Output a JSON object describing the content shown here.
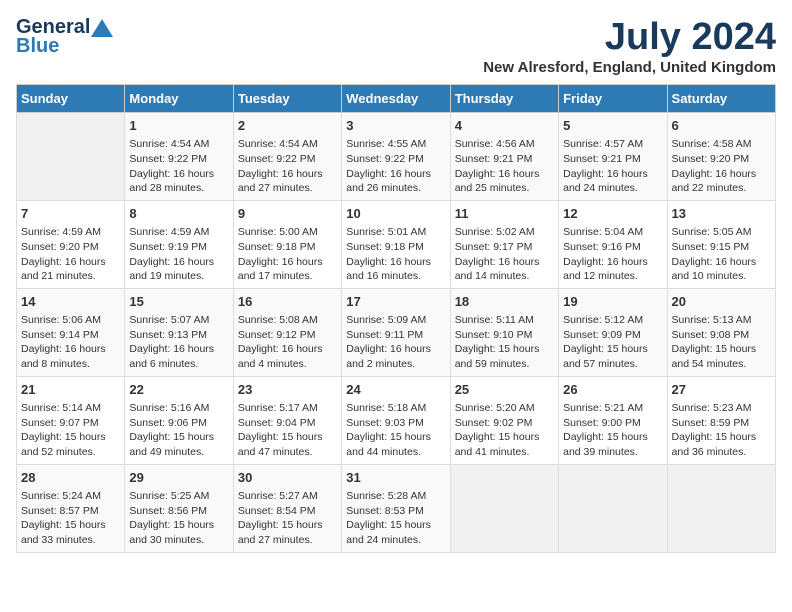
{
  "logo": {
    "general": "General",
    "blue": "Blue"
  },
  "title": "July 2024",
  "location": "New Alresford, England, United Kingdom",
  "days_of_week": [
    "Sunday",
    "Monday",
    "Tuesday",
    "Wednesday",
    "Thursday",
    "Friday",
    "Saturday"
  ],
  "weeks": [
    [
      {
        "day": "",
        "info": ""
      },
      {
        "day": "1",
        "info": "Sunrise: 4:54 AM\nSunset: 9:22 PM\nDaylight: 16 hours\nand 28 minutes."
      },
      {
        "day": "2",
        "info": "Sunrise: 4:54 AM\nSunset: 9:22 PM\nDaylight: 16 hours\nand 27 minutes."
      },
      {
        "day": "3",
        "info": "Sunrise: 4:55 AM\nSunset: 9:22 PM\nDaylight: 16 hours\nand 26 minutes."
      },
      {
        "day": "4",
        "info": "Sunrise: 4:56 AM\nSunset: 9:21 PM\nDaylight: 16 hours\nand 25 minutes."
      },
      {
        "day": "5",
        "info": "Sunrise: 4:57 AM\nSunset: 9:21 PM\nDaylight: 16 hours\nand 24 minutes."
      },
      {
        "day": "6",
        "info": "Sunrise: 4:58 AM\nSunset: 9:20 PM\nDaylight: 16 hours\nand 22 minutes."
      }
    ],
    [
      {
        "day": "7",
        "info": "Sunrise: 4:59 AM\nSunset: 9:20 PM\nDaylight: 16 hours\nand 21 minutes."
      },
      {
        "day": "8",
        "info": "Sunrise: 4:59 AM\nSunset: 9:19 PM\nDaylight: 16 hours\nand 19 minutes."
      },
      {
        "day": "9",
        "info": "Sunrise: 5:00 AM\nSunset: 9:18 PM\nDaylight: 16 hours\nand 17 minutes."
      },
      {
        "day": "10",
        "info": "Sunrise: 5:01 AM\nSunset: 9:18 PM\nDaylight: 16 hours\nand 16 minutes."
      },
      {
        "day": "11",
        "info": "Sunrise: 5:02 AM\nSunset: 9:17 PM\nDaylight: 16 hours\nand 14 minutes."
      },
      {
        "day": "12",
        "info": "Sunrise: 5:04 AM\nSunset: 9:16 PM\nDaylight: 16 hours\nand 12 minutes."
      },
      {
        "day": "13",
        "info": "Sunrise: 5:05 AM\nSunset: 9:15 PM\nDaylight: 16 hours\nand 10 minutes."
      }
    ],
    [
      {
        "day": "14",
        "info": "Sunrise: 5:06 AM\nSunset: 9:14 PM\nDaylight: 16 hours\nand 8 minutes."
      },
      {
        "day": "15",
        "info": "Sunrise: 5:07 AM\nSunset: 9:13 PM\nDaylight: 16 hours\nand 6 minutes."
      },
      {
        "day": "16",
        "info": "Sunrise: 5:08 AM\nSunset: 9:12 PM\nDaylight: 16 hours\nand 4 minutes."
      },
      {
        "day": "17",
        "info": "Sunrise: 5:09 AM\nSunset: 9:11 PM\nDaylight: 16 hours\nand 2 minutes."
      },
      {
        "day": "18",
        "info": "Sunrise: 5:11 AM\nSunset: 9:10 PM\nDaylight: 15 hours\nand 59 minutes."
      },
      {
        "day": "19",
        "info": "Sunrise: 5:12 AM\nSunset: 9:09 PM\nDaylight: 15 hours\nand 57 minutes."
      },
      {
        "day": "20",
        "info": "Sunrise: 5:13 AM\nSunset: 9:08 PM\nDaylight: 15 hours\nand 54 minutes."
      }
    ],
    [
      {
        "day": "21",
        "info": "Sunrise: 5:14 AM\nSunset: 9:07 PM\nDaylight: 15 hours\nand 52 minutes."
      },
      {
        "day": "22",
        "info": "Sunrise: 5:16 AM\nSunset: 9:06 PM\nDaylight: 15 hours\nand 49 minutes."
      },
      {
        "day": "23",
        "info": "Sunrise: 5:17 AM\nSunset: 9:04 PM\nDaylight: 15 hours\nand 47 minutes."
      },
      {
        "day": "24",
        "info": "Sunrise: 5:18 AM\nSunset: 9:03 PM\nDaylight: 15 hours\nand 44 minutes."
      },
      {
        "day": "25",
        "info": "Sunrise: 5:20 AM\nSunset: 9:02 PM\nDaylight: 15 hours\nand 41 minutes."
      },
      {
        "day": "26",
        "info": "Sunrise: 5:21 AM\nSunset: 9:00 PM\nDaylight: 15 hours\nand 39 minutes."
      },
      {
        "day": "27",
        "info": "Sunrise: 5:23 AM\nSunset: 8:59 PM\nDaylight: 15 hours\nand 36 minutes."
      }
    ],
    [
      {
        "day": "28",
        "info": "Sunrise: 5:24 AM\nSunset: 8:57 PM\nDaylight: 15 hours\nand 33 minutes."
      },
      {
        "day": "29",
        "info": "Sunrise: 5:25 AM\nSunset: 8:56 PM\nDaylight: 15 hours\nand 30 minutes."
      },
      {
        "day": "30",
        "info": "Sunrise: 5:27 AM\nSunset: 8:54 PM\nDaylight: 15 hours\nand 27 minutes."
      },
      {
        "day": "31",
        "info": "Sunrise: 5:28 AM\nSunset: 8:53 PM\nDaylight: 15 hours\nand 24 minutes."
      },
      {
        "day": "",
        "info": ""
      },
      {
        "day": "",
        "info": ""
      },
      {
        "day": "",
        "info": ""
      }
    ]
  ]
}
